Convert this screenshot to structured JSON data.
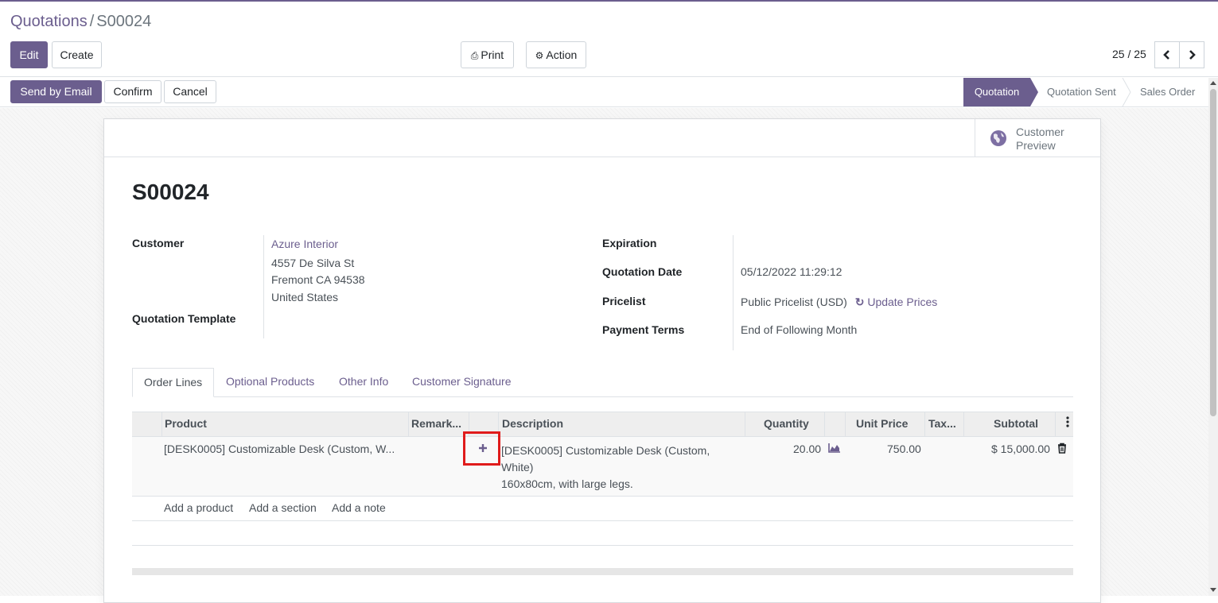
{
  "breadcrumb": {
    "parent": "Quotations",
    "separator": "/",
    "current": "S00024"
  },
  "toolbar": {
    "edit": "Edit",
    "create": "Create",
    "print": "Print",
    "action": "Action",
    "pager": "25 / 25"
  },
  "statusbar": {
    "send_email": "Send by Email",
    "confirm": "Confirm",
    "cancel": "Cancel",
    "stages": [
      "Quotation",
      "Quotation Sent",
      "Sales Order"
    ],
    "active_stage": "Quotation"
  },
  "smart_button": {
    "line1": "Customer",
    "line2": "Preview",
    "icon": "globe-icon"
  },
  "record": {
    "name": "S00024",
    "customer_label": "Customer",
    "customer_name": "Azure Interior",
    "address": [
      "4557 De Silva St",
      "Fremont CA 94538",
      "United States"
    ],
    "template_label": "Quotation Template",
    "expiration_label": "Expiration",
    "quotation_date_label": "Quotation Date",
    "quotation_date": "05/12/2022 11:29:12",
    "pricelist_label": "Pricelist",
    "pricelist": "Public Pricelist (USD)",
    "update_prices": "Update Prices",
    "payment_terms_label": "Payment Terms",
    "payment_terms": "End of Following Month"
  },
  "tabs": [
    "Order Lines",
    "Optional Products",
    "Other Info",
    "Customer Signature"
  ],
  "table": {
    "headers": {
      "product": "Product",
      "remarks": "Remark...",
      "description": "Description",
      "quantity": "Quantity",
      "unit_price": "Unit Price",
      "taxes": "Tax...",
      "subtotal": "Subtotal"
    },
    "rows": [
      {
        "product": "[DESK0005] Customizable Desk (Custom, W...",
        "description_lines": [
          "[DESK0005] Customizable Desk (Custom,",
          "White)",
          "160x80cm, with large legs."
        ],
        "quantity": "20.00",
        "unit_price": "750.00",
        "subtotal": "$ 15,000.00"
      }
    ],
    "add_product": "Add a product",
    "add_section": "Add a section",
    "add_note": "Add a note"
  },
  "colors": {
    "brand": "#6b5e8e",
    "highlight": "#e01b1b"
  }
}
